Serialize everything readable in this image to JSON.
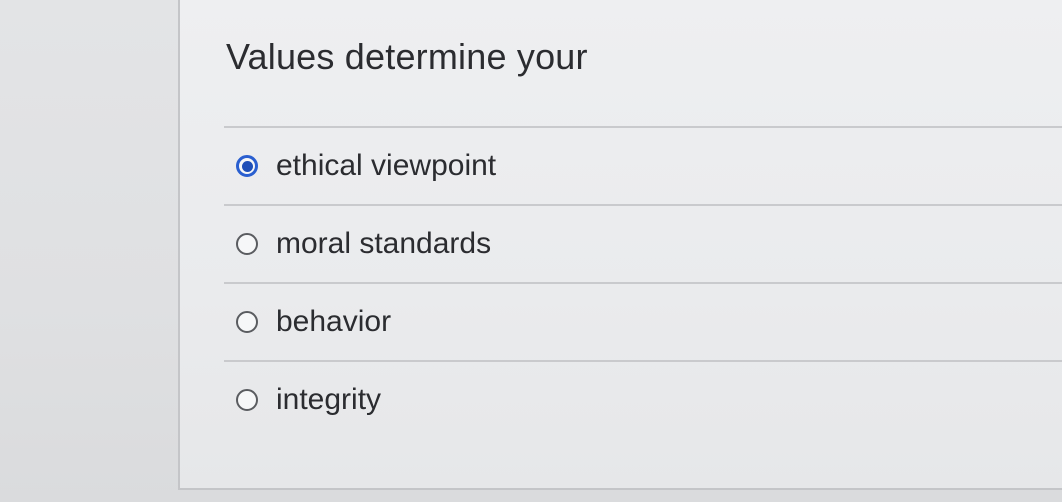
{
  "question": {
    "text": "Values determine your"
  },
  "answers": [
    {
      "label": "ethical viewpoint",
      "selected": true
    },
    {
      "label": "moral standards",
      "selected": false
    },
    {
      "label": "behavior",
      "selected": false
    },
    {
      "label": "integrity",
      "selected": false
    }
  ],
  "colors": {
    "selected_radio": "#2a5fd0",
    "text": "#2b2c30",
    "background": "#e3e4e6"
  }
}
